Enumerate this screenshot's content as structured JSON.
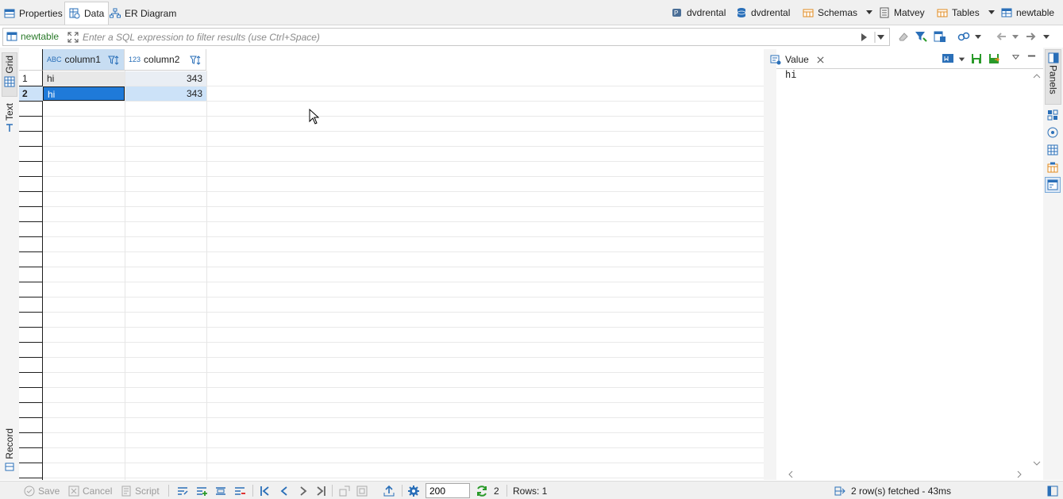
{
  "tabs": {
    "properties": "Properties",
    "data": "Data",
    "er_diagram": "ER Diagram"
  },
  "breadcrumb": {
    "connection": "dvdrental",
    "database": "dvdrental",
    "schemas": "Schemas",
    "schema": "Matvey",
    "tables": "Tables",
    "table": "newtable"
  },
  "filter": {
    "table_label": "newtable",
    "placeholder": "Enter a SQL expression to filter results (use Ctrl+Space)"
  },
  "side_tabs": {
    "grid": "Grid",
    "text": "Text",
    "record": "Record"
  },
  "grid": {
    "columns": [
      {
        "type_badge": "ABC",
        "name": "column1"
      },
      {
        "type_badge": "123",
        "name": "column2"
      }
    ],
    "rows": [
      {
        "num": "1",
        "column1": "hi",
        "column2": "343"
      },
      {
        "num": "2",
        "column1": "hi",
        "column2": "343"
      }
    ],
    "selected_row": 2
  },
  "value_panel": {
    "title": "Value",
    "content": "hi"
  },
  "right_strip": {
    "panels_label": "Panels"
  },
  "status": {
    "save": "Save",
    "cancel": "Cancel",
    "script": "Script",
    "fetch_limit": "200",
    "refresh_count": "2",
    "rows": "Rows: 1",
    "fetched": "2 row(s) fetched - 43ms"
  },
  "colors": {
    "selection": "#1f7ad9",
    "selection_light": "#cce2f8",
    "column_selected_header": "#c7ddf2",
    "accent_blue": "#2a6fb8",
    "green": "#2a9a2a",
    "orange": "#e08a1e"
  }
}
